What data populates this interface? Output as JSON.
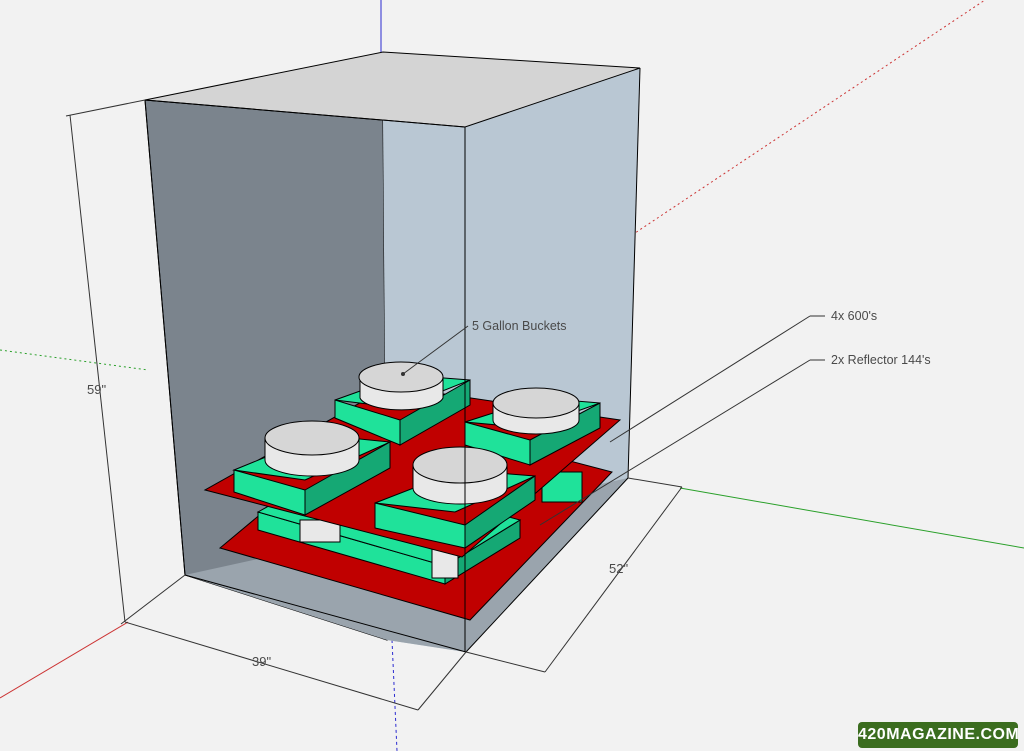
{
  "dimensions": {
    "height": "59\"",
    "width": "39\"",
    "depth": "52\""
  },
  "callouts": {
    "buckets": "5 Gallon Buckets",
    "lights": "4x 600's",
    "reflectors": "2x Reflector 144's"
  },
  "watermark": "420MAGAZINE.COM",
  "colors": {
    "reflector_red": "#c00000",
    "bucket_base_green": "#1fe29a",
    "bucket_white": "#e8e8e8",
    "tent_dark": "#7b848d",
    "tent_light": "#b9c7d3",
    "axis_blue": "#2a2ad0",
    "axis_red": "#cc3333",
    "axis_green": "#2aa02a"
  }
}
